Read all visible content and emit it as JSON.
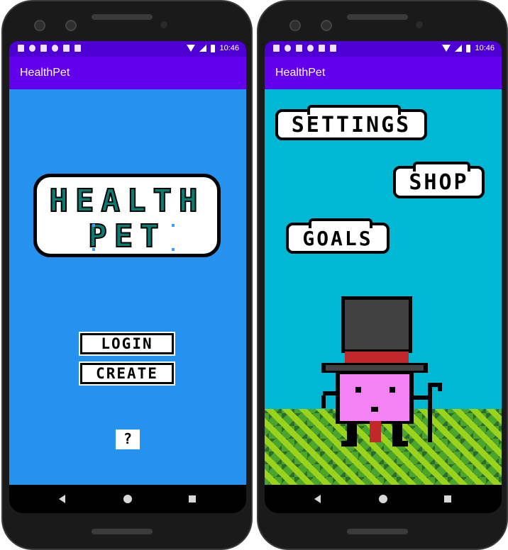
{
  "status_bar": {
    "time": "10:46"
  },
  "app": {
    "title": "HealthPet"
  },
  "login_screen": {
    "logo": {
      "line1": "HEALTH",
      "line2": "PET"
    },
    "login_button": "LOGIN",
    "create_button": "CREATE",
    "help_button": "?"
  },
  "home_screen": {
    "settings_button": "SETTINGS",
    "shop_button": "SHOP",
    "goals_button": "GOALS",
    "pet": {
      "hat": "top-hat",
      "body_color": "#f482f4",
      "tie_color": "#c0282c"
    }
  },
  "colors": {
    "status_bar": "#4e00d4",
    "app_bar": "#6200ee",
    "login_background": "#2492ee",
    "home_background": "#00b8d4",
    "logo_text": "#0c7c72",
    "grass_light": "#9bd21c",
    "grass_dark": "#2f6b2a"
  },
  "nav_icons": [
    "back-icon",
    "home-icon",
    "recents-icon"
  ]
}
